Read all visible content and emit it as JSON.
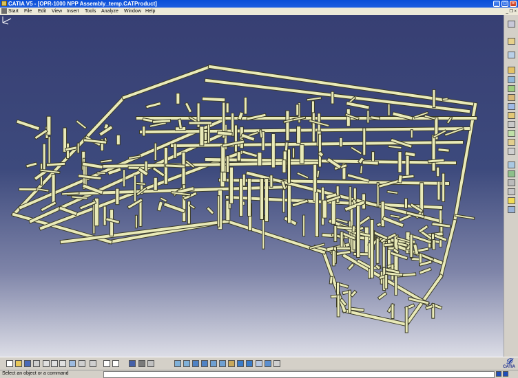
{
  "window": {
    "title": "CATIA V5 - [OPR-1000 NPP Assembly_temp.CATProduct]",
    "controls": [
      "_",
      "□",
      "×"
    ]
  },
  "menu": {
    "items": [
      "Start",
      "File",
      "Edit",
      "View",
      "Insert",
      "Tools",
      "Analyze",
      "Window",
      "Help"
    ],
    "right_controls": "_ ❐ ×"
  },
  "viewport": {
    "background_top": "#373f73",
    "background_bottom": "#dcdde6",
    "pipe_color": "#e9eab8",
    "edge_color": "#3a3a26",
    "compass_icon": "axis-compass-icon"
  },
  "right_toolbar": {
    "icons": [
      "product-icon",
      "pointer-icon",
      "select-icon",
      "assembly-icon",
      "component-icon",
      "part-icon",
      "load-icon",
      "replace-icon",
      "reorder-icon",
      "numbering-icon",
      "bom-icon",
      "catalog-icon",
      "constraint-icon",
      "snap-icon",
      "scene-icon",
      "measure-icon",
      "section-icon",
      "light-icon",
      "tools-icon"
    ]
  },
  "bottom_toolbar": {
    "icons": [
      "new-icon",
      "open-icon",
      "save-icon",
      "print-icon",
      "cut-icon",
      "copy-icon",
      "paste-icon",
      "undo-icon",
      "redo-icon",
      "what-icon",
      "fx-icon",
      "comment-icon",
      "catalog-icon",
      "model-icon",
      "publish-icon",
      "fly-icon",
      "fit-all-icon",
      "pan-icon",
      "rotate-icon",
      "zoom-in-icon",
      "zoom-out-icon",
      "normal-view-icon",
      "iso-view-icon",
      "shading-icon",
      "hide-show-icon",
      "swap-icon",
      "properties-icon"
    ],
    "logo_text": "CATIA"
  },
  "status": {
    "message": "Select an object or a command"
  }
}
